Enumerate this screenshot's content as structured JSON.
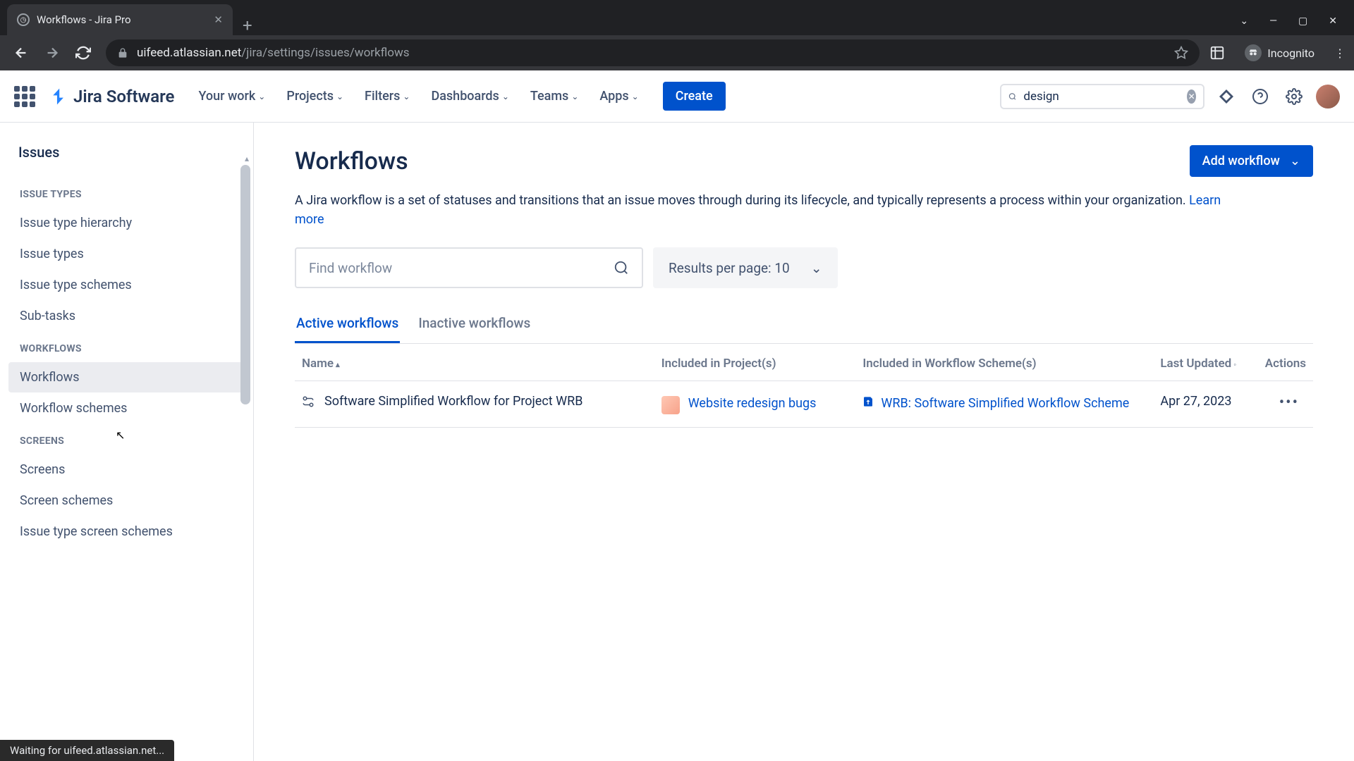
{
  "browser": {
    "tab_title": "Workflows - Jira Pro",
    "url_domain": "uifeed.atlassian.net",
    "url_path": "/jira/settings/issues/workflows",
    "incognito_label": "Incognito",
    "status_text": "Waiting for uifeed.atlassian.net..."
  },
  "nav": {
    "logo": "Jira Software",
    "items": [
      "Your work",
      "Projects",
      "Filters",
      "Dashboards",
      "Teams",
      "Apps"
    ],
    "create": "Create",
    "search_value": "design"
  },
  "sidebar": {
    "title": "Issues",
    "sections": [
      {
        "heading": "ISSUE TYPES",
        "items": [
          "Issue type hierarchy",
          "Issue types",
          "Issue type schemes",
          "Sub-tasks"
        ]
      },
      {
        "heading": "WORKFLOWS",
        "items": [
          "Workflows",
          "Workflow schemes"
        ]
      },
      {
        "heading": "SCREENS",
        "items": [
          "Screens",
          "Screen schemes",
          "Issue type screen schemes"
        ]
      }
    ]
  },
  "page": {
    "title": "Workflows",
    "add_button": "Add workflow",
    "description": "A Jira workflow is a set of statuses and transitions that an issue moves through during its lifecycle, and typically represents a process within your organization. ",
    "learn_more": "Learn more",
    "find_placeholder": "Find workflow",
    "results_label": "Results per page: 10",
    "tabs": [
      "Active workflows",
      "Inactive workflows"
    ],
    "columns": {
      "name": "Name",
      "projects": "Included in Project(s)",
      "schemes": "Included in Workflow Scheme(s)",
      "updated": "Last Updated",
      "actions": "Actions"
    },
    "rows": [
      {
        "name": "Software Simplified Workflow for Project WRB",
        "project": "Website redesign bugs",
        "scheme": "WRB: Software Simplified Workflow Scheme",
        "updated": "Apr 27, 2023"
      }
    ]
  }
}
